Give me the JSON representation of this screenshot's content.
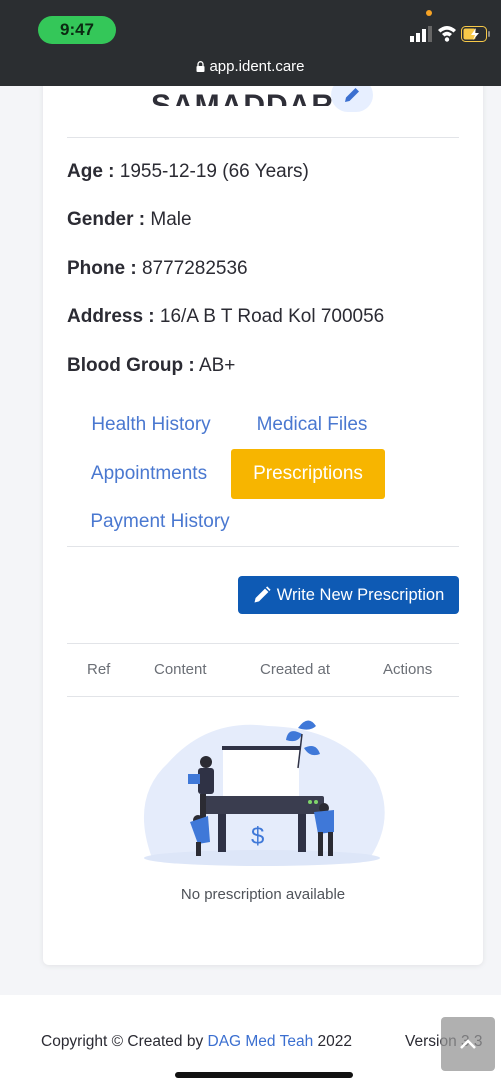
{
  "status_bar": {
    "time": "9:47",
    "url": "app.ident.care"
  },
  "patient": {
    "name": "SAMADDAR",
    "fields": [
      {
        "label": "Age :",
        "value": "1955-12-19 (66 Years)"
      },
      {
        "label": "Gender :",
        "value": "Male"
      },
      {
        "label": "Phone :",
        "value": "8777282536"
      },
      {
        "label": "Address :",
        "value": "16/A B T Road Kol 700056"
      },
      {
        "label": "Blood Group :",
        "value": "AB+"
      }
    ]
  },
  "tabs": [
    {
      "label": "Health History"
    },
    {
      "label": "Medical Files"
    },
    {
      "label": "Appointments"
    },
    {
      "label": "Prescriptions",
      "active": true
    },
    {
      "label": "Payment History"
    }
  ],
  "prescriptions": {
    "write_button_label": "Write New Prescription",
    "columns": [
      "Ref",
      "Content",
      "Created at",
      "Actions"
    ],
    "empty_message": "No prescription available"
  },
  "footer": {
    "copyright_prefix": "Copyright © Created by ",
    "company": "DAG Med Teah",
    "year": " 2022",
    "version": "Version 3.3"
  },
  "colors": {
    "accent": "#f7b500",
    "primary": "#0e5ab4",
    "link": "#4a78d0"
  }
}
